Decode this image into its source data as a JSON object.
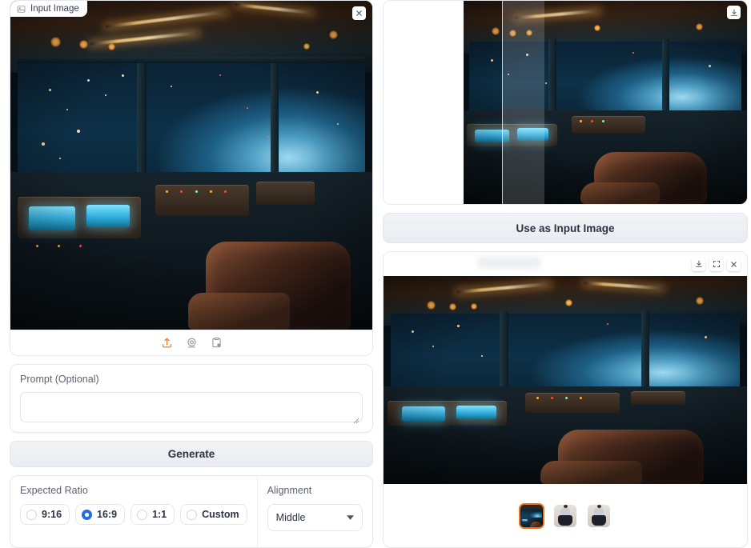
{
  "app": {
    "accent_orange": "#e8741f",
    "accent_blue": "#1f6fe5",
    "bg": "#ffffff"
  },
  "input_panel": {
    "badge_label": "Input Image",
    "badge_icon": "image-icon",
    "close_icon": "close-icon",
    "image_alt": "Spacecraft cockpit interior with planet Earth seen through windows",
    "toolbar": [
      {
        "name": "upload-icon",
        "label": "Upload",
        "color": "#e8741f"
      },
      {
        "name": "webcam-icon",
        "label": "Webcam",
        "color": "#8d939b"
      },
      {
        "name": "clipboard-icon",
        "label": "Paste from clipboard",
        "color": "#8d939b"
      }
    ]
  },
  "prompt": {
    "label": "Prompt (Optional)",
    "value": "",
    "placeholder": ""
  },
  "actions": {
    "generate_label": "Generate",
    "use_as_input_label": "Use as Input Image"
  },
  "expected_ratio": {
    "label": "Expected Ratio",
    "selected": "16:9",
    "options": [
      {
        "label": "9:16",
        "selected": false
      },
      {
        "label": "16:9",
        "selected": true
      },
      {
        "label": "1:1",
        "selected": false
      },
      {
        "label": "Custom",
        "selected": false
      }
    ]
  },
  "alignment": {
    "label": "Alignment",
    "selected": "Middle",
    "caret_icon": "chevron-down-icon"
  },
  "compare_panel": {
    "download_icon": "download-icon",
    "image_alt": "Outpainted cockpit comparison with slider"
  },
  "output_panel": {
    "header_icons": [
      {
        "name": "download-icon",
        "label": "Download"
      },
      {
        "name": "fullscreen-icon",
        "label": "Fullscreen"
      },
      {
        "name": "close-icon",
        "label": "Close"
      }
    ],
    "image_alt": "Generated wide cockpit image",
    "gallery": [
      {
        "name": "thumbnail-cockpit",
        "selected": true,
        "kind": "cockpit"
      },
      {
        "name": "thumbnail-person-1",
        "selected": false,
        "kind": "person"
      },
      {
        "name": "thumbnail-person-2",
        "selected": false,
        "kind": "person"
      }
    ]
  }
}
